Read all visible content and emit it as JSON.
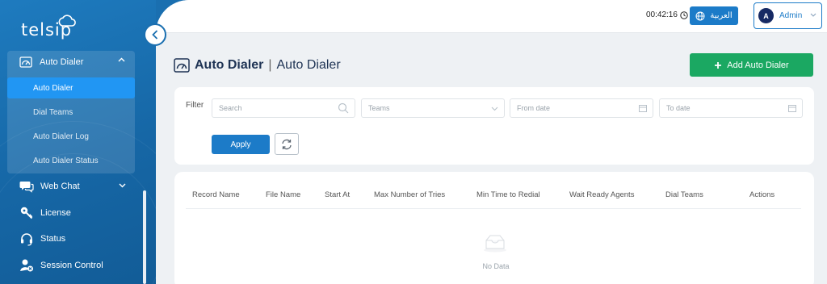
{
  "brand": {
    "logo_text": "telsip"
  },
  "sidebar": {
    "group": {
      "label": "Auto Dialer",
      "items": [
        {
          "label": "Auto Dialer",
          "active": true
        },
        {
          "label": "Dial Teams",
          "active": false
        },
        {
          "label": "Auto Dialer Log",
          "active": false
        },
        {
          "label": "Auto Dialer Status",
          "active": false
        }
      ]
    },
    "items": [
      {
        "label": "Web Chat",
        "icon": "chat-icon",
        "has_chevron": true
      },
      {
        "label": "License",
        "icon": "key-icon",
        "has_chevron": false
      },
      {
        "label": "Status",
        "icon": "headset-icon",
        "has_chevron": false
      },
      {
        "label": "Session Control",
        "icon": "user-session-icon",
        "has_chevron": false
      }
    ]
  },
  "header": {
    "clock": "00:42:16",
    "language_button": "العربية",
    "user": {
      "initial": "A",
      "name": "Admin"
    }
  },
  "page": {
    "title_primary": "Auto Dialer",
    "title_secondary": "Auto Dialer",
    "add_button": "Add Auto Dialer"
  },
  "filter": {
    "label": "Filter",
    "search_placeholder": "Search",
    "teams_placeholder": "Teams",
    "from_date_placeholder": "From date",
    "to_date_placeholder": "To date",
    "apply_label": "Apply"
  },
  "table": {
    "columns": [
      "Record Name",
      "File Name",
      "Start At",
      "Max Number of Tries",
      "Min Time to Redial",
      "Wait Ready Agents",
      "Dial Teams",
      "Actions"
    ],
    "empty_text": "No Data"
  },
  "colors": {
    "sidebar": "#1a6fb0",
    "accent": "#1c7bc8",
    "active_item": "#2196f3",
    "success": "#1ba862"
  }
}
